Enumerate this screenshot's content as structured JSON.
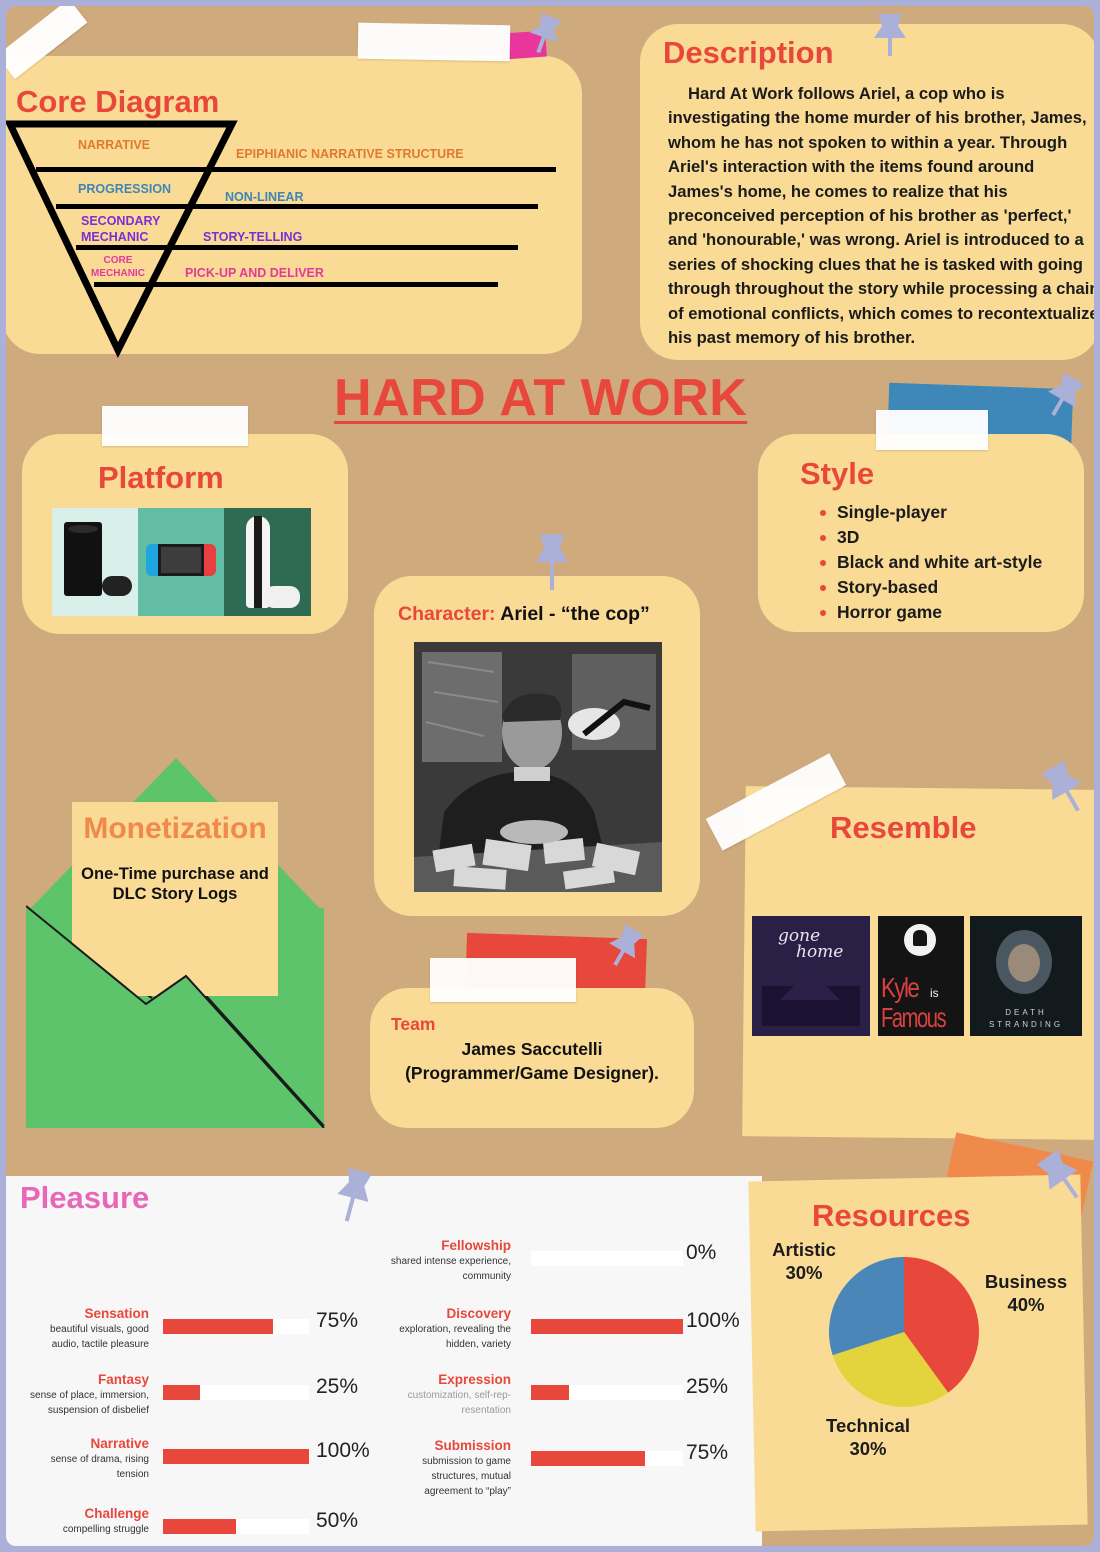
{
  "poster_title": "HARD AT WORK",
  "colors": {
    "accent_red": "#e8473b",
    "card_yellow": "#fadb95",
    "board_tan": "#cfaa7c",
    "frame": "#aab0d8"
  },
  "core_diagram": {
    "title": "Core Diagram",
    "layers": [
      {
        "label": "NARRATIVE",
        "value": "EPIPHIANIC NARRATIVE STRUCTURE",
        "color": "#e07a2e"
      },
      {
        "label": "PROGRESSION",
        "value": "NON-LINEAR",
        "color": "#3f86b5"
      },
      {
        "label": "SECONDARY MECHANIC",
        "value": "STORY-TELLING",
        "color": "#7b2fd4"
      },
      {
        "label": "CORE MECHANIC",
        "value": "PICK-UP AND DELIVER",
        "color": "#e23a9a"
      }
    ]
  },
  "description": {
    "title": "Description",
    "text": "Hard At Work follows Ariel, a cop who is investigating the home murder of his brother, James, whom he has not spoken to within a year. Through Ariel's interaction with the items found around James's home, he comes to realize that his preconceived perception of his brother as 'perfect,' and 'honourable,' was wrong. Ariel is introduced to a series of shocking clues that he is tasked with going through throughout the story while processing a chain of emotional conflicts, which comes to recontextualize his past memory of his brother."
  },
  "platform": {
    "title": "Platform",
    "images": [
      "xbox-console-icon",
      "nintendo-switch-icon",
      "playstation-console-icon"
    ]
  },
  "style": {
    "title": "Style",
    "items": [
      "Single-player",
      "3D",
      "Black and white art-style",
      "Story-based",
      "Horror game"
    ]
  },
  "character": {
    "label": "Character:",
    "name": "Ariel - “the cop”",
    "image": "detective-portrait"
  },
  "monetization": {
    "title": "Monetization",
    "text": "One-Time purchase and DLC Story Logs"
  },
  "resemble": {
    "title": "Resemble",
    "games": [
      {
        "line1": "gone",
        "line2": "home"
      },
      {
        "line1": "Kyle",
        "line2": "Famous",
        "small": "is"
      },
      {
        "line1": "DEATH",
        "line2": "STRANDING"
      }
    ]
  },
  "team": {
    "title": "Team",
    "member": "James Saccutelli",
    "role": "(Programmer/Game Designer)."
  },
  "pleasure": {
    "title": "Pleasure",
    "left": [
      {
        "name": "Sensation",
        "desc": [
          "beautiful visuals, good",
          "audio, tactile pleasure"
        ],
        "percent": 75,
        "value": "75%"
      },
      {
        "name": "Fantasy",
        "desc": [
          "sense of place, immersion,",
          "suspension of disbelief"
        ],
        "percent": 25,
        "value": "25%"
      },
      {
        "name": "Narrative",
        "desc": [
          "sense of drama, rising",
          "tension"
        ],
        "percent": 100,
        "value": "100%"
      },
      {
        "name": "Challenge",
        "desc": [
          "compelling struggle"
        ],
        "percent": 50,
        "value": "50%"
      }
    ],
    "right": [
      {
        "name": "Fellowship",
        "desc": [
          "shared intense experience,",
          "community"
        ],
        "percent": 0,
        "value": "0%"
      },
      {
        "name": "Discovery",
        "desc": [
          "exploration, revealing the",
          "hidden, variety"
        ],
        "percent": 100,
        "value": "100%"
      },
      {
        "name": "Expression",
        "desc": [
          "customization, self-rep-",
          "resentation"
        ],
        "percent": 25,
        "value": "25%"
      },
      {
        "name": "Submission",
        "desc": [
          "submission to game",
          "structures, mutual",
          "agreement to “play”"
        ],
        "percent": 75,
        "value": "75%"
      }
    ]
  },
  "resources": {
    "title": "Resources",
    "chart_data": {
      "type": "pie",
      "slices": [
        {
          "label": "Business",
          "value": 40,
          "display": "40%",
          "color": "#e8473b"
        },
        {
          "label": "Technical",
          "value": 30,
          "display": "30%",
          "color": "#e3d43d"
        },
        {
          "label": "Artistic",
          "value": 30,
          "display": "30%",
          "color": "#4a87b8"
        }
      ]
    }
  }
}
